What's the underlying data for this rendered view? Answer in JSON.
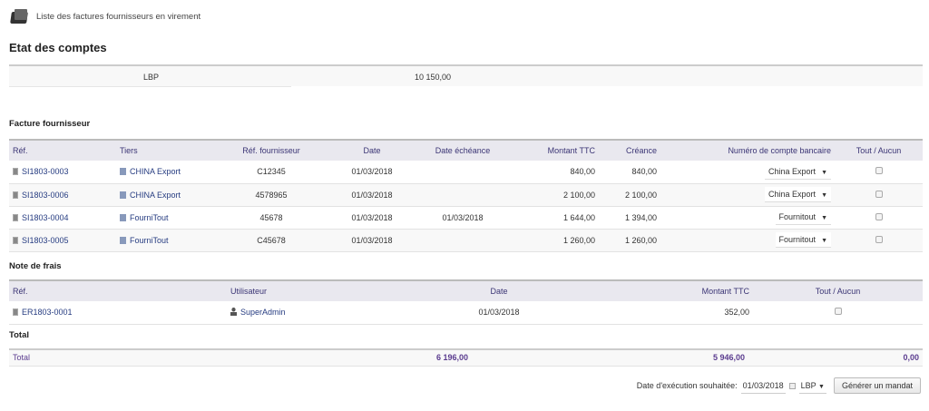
{
  "header": {
    "title": "Liste des factures fournisseurs en virement"
  },
  "accounts": {
    "title": "Etat des comptes",
    "currency": "LBP",
    "balance": "10 150,00"
  },
  "invoices": {
    "title": "Facture fournisseur",
    "columns": [
      "Réf.",
      "Tiers",
      "Réf. fournisseur",
      "Date",
      "Date échéance",
      "Montant TTC",
      "Créance",
      "Numéro de compte bancaire",
      "Tout / Aucun"
    ],
    "rows": [
      {
        "ref": "SI1803-0003",
        "tiers": "CHINA Export",
        "ref_fourn": "C12345",
        "date": "01/03/2018",
        "echeance": "",
        "montant": "840,00",
        "creance": "840,00",
        "compte": "China Export"
      },
      {
        "ref": "SI1803-0006",
        "tiers": "CHINA Export",
        "ref_fourn": "4578965",
        "date": "01/03/2018",
        "echeance": "",
        "montant": "2 100,00",
        "creance": "2 100,00",
        "compte": "China Export"
      },
      {
        "ref": "SI1803-0004",
        "tiers": "FourniTout",
        "ref_fourn": "45678",
        "date": "01/03/2018",
        "echeance": "01/03/2018",
        "montant": "1 644,00",
        "creance": "1 394,00",
        "compte": "Fournitout"
      },
      {
        "ref": "SI1803-0005",
        "tiers": "FourniTout",
        "ref_fourn": "C45678",
        "date": "01/03/2018",
        "echeance": "",
        "montant": "1 260,00",
        "creance": "1 260,00",
        "compte": "Fournitout"
      }
    ]
  },
  "expenses": {
    "title": "Note de frais",
    "columns": [
      "Réf.",
      "Utilisateur",
      "Date",
      "Montant TTC",
      "Tout / Aucun"
    ],
    "rows": [
      {
        "ref": "ER1803-0001",
        "user": "SuperAdmin",
        "date": "01/03/2018",
        "montant": "352,00"
      }
    ]
  },
  "total": {
    "title": "Total",
    "label": "Total",
    "v1": "6 196,00",
    "v2": "5 946,00",
    "v3": "0,00"
  },
  "footer": {
    "date_label": "Date d'exécution souhaitée:",
    "date": "01/03/2018",
    "currency": "LBP",
    "button": "Générer un mandat"
  }
}
